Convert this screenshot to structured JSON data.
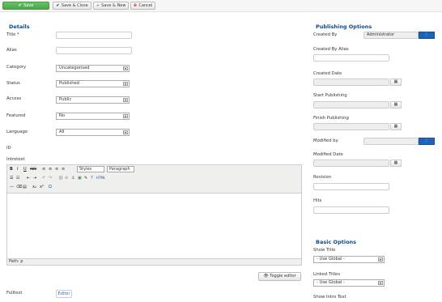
{
  "toolbar": {
    "save": "Save",
    "save_close": "Save & Close",
    "save_new": "Save & New",
    "cancel": "Cancel"
  },
  "details": {
    "title": "Details",
    "fields": {
      "title_label": "Title *",
      "alias_label": "Alias",
      "category_label": "Category",
      "category_value": "Uncategorised",
      "status_label": "Status",
      "status_value": "Published",
      "access_label": "Access",
      "access_value": "Public",
      "featured_label": "Featured",
      "featured_value": "No",
      "language_label": "Language",
      "language_value": "All",
      "id_label": "ID",
      "introtext_label": "Introtext",
      "fulltext_label": "Fulltext"
    },
    "editor": {
      "styles": "Styles",
      "paragraph": "Paragraph",
      "path": "Path: p",
      "toggle": "Toggle editor",
      "editor_button": "Editor"
    }
  },
  "publishing": {
    "title": "Publishing Options",
    "created_by_label": "Created By",
    "created_by_value": "Administrator",
    "created_by_alias_label": "Created By Alias",
    "created_date_label": "Created Date",
    "start_publishing_label": "Start Publishing",
    "finish_publishing_label": "Finish Publishing",
    "modified_by_label": "Modified by",
    "modified_date_label": "Modified Date",
    "revision_label": "Revision",
    "hits_label": "Hits"
  },
  "basic": {
    "title": "Basic Options",
    "show_title_label": "Show Title",
    "show_title_value": "- Use Global -",
    "linked_titles_label": "Linked Titles",
    "linked_titles_value": "- Use Global -",
    "show_intro_label": "Show Intro Text"
  },
  "icons": {
    "save": "✔",
    "save_new": "+",
    "cancel": "⊗",
    "calendar": "▦",
    "user": "👤",
    "toggle": "👁",
    "arrow": "▾"
  },
  "colors": {
    "accent": "#0a4a8a",
    "save_green": "#51a351",
    "user_blue": "#1e63b6"
  }
}
